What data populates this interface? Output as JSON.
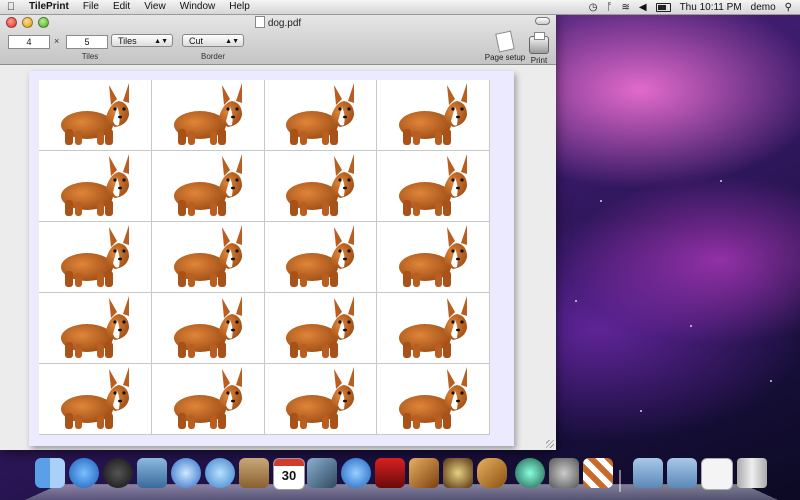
{
  "menubar": {
    "app_name": "TilePrint",
    "items": [
      "File",
      "Edit",
      "View",
      "Window",
      "Help"
    ],
    "clock": "Thu 10:11 PM",
    "user": "demo"
  },
  "window": {
    "title": "dog.pdf",
    "toolbar": {
      "columns_value": "4",
      "times_symbol": "×",
      "rows_value": "5",
      "mode_value": "Tiles",
      "border_value": "Cut",
      "tiles_label": "Tiles",
      "border_label": "Border",
      "page_setup_label": "Page setup",
      "print_label": "Print"
    }
  },
  "document": {
    "columns": 4,
    "rows": 5
  },
  "dock": {
    "calendar_day": "30",
    "apps": [
      "Finder",
      "App Store",
      "Dashboard",
      "Mail",
      "Safari",
      "FaceTime",
      "Address Book",
      "iCal",
      "iPhoto",
      "iTunes",
      "Photo Booth",
      "Preview",
      "iMovie",
      "GarageBand",
      "Time Machine",
      "System Preferences",
      "TilePrint",
      "Applications",
      "Documents",
      "Downloads",
      "Trash"
    ]
  }
}
